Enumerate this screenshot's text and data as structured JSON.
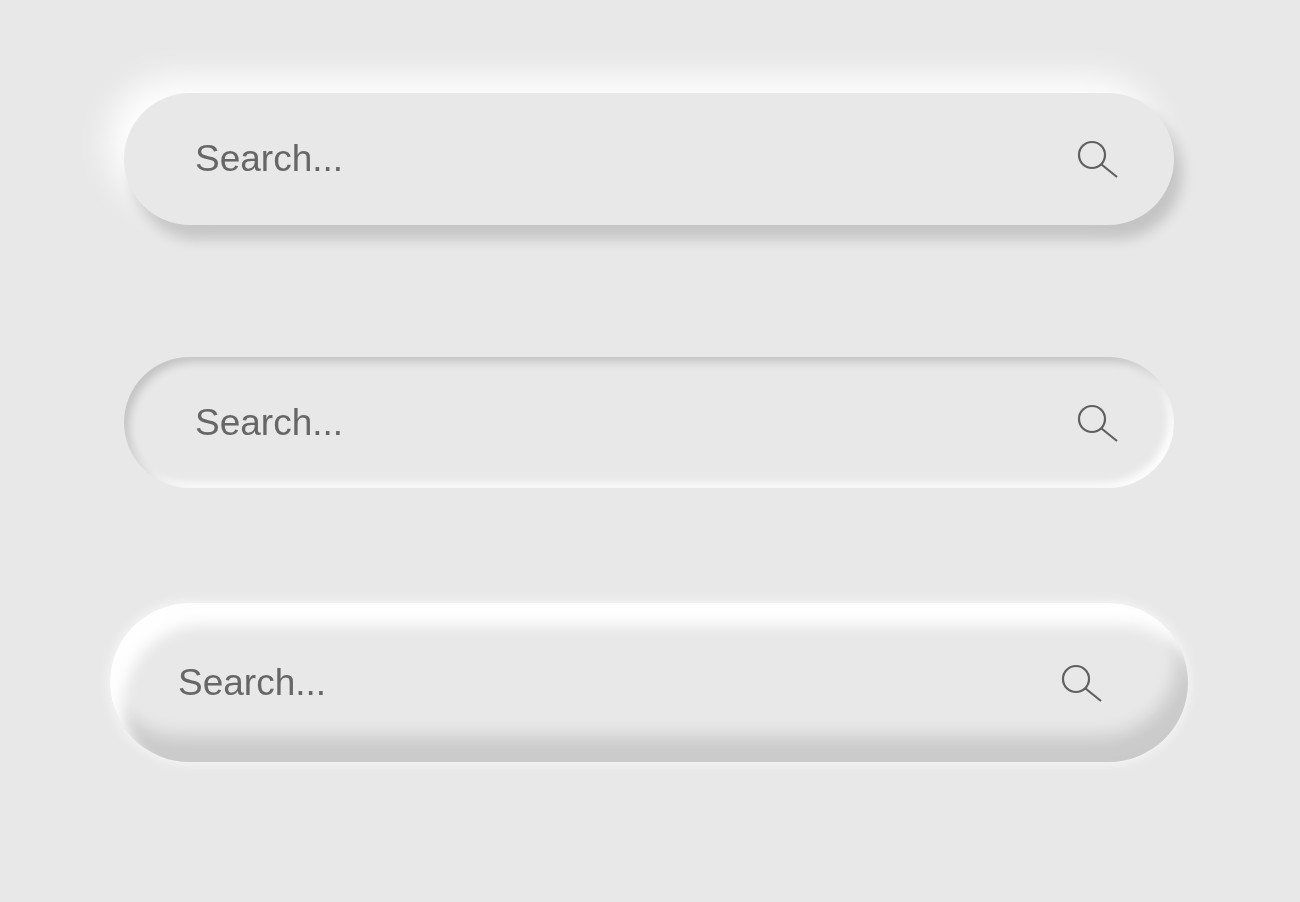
{
  "search_bars": [
    {
      "kind": "raised",
      "placeholder": "Search..."
    },
    {
      "kind": "inset",
      "placeholder": "Search..."
    },
    {
      "kind": "bevel",
      "placeholder": "Search..."
    }
  ]
}
